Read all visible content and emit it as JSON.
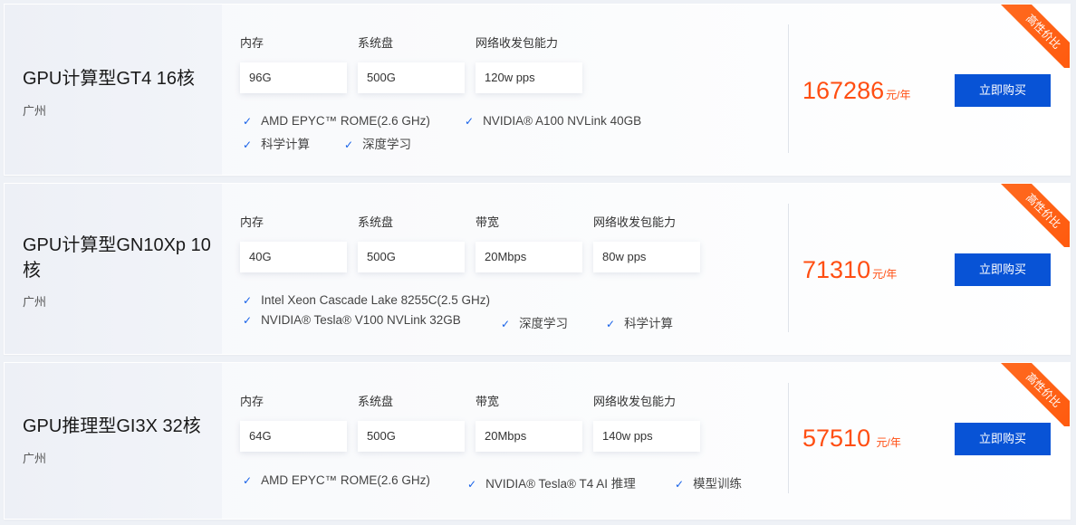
{
  "products": [
    {
      "title": "GPU计算型GT4 16核",
      "region": "广州",
      "specs": [
        {
          "label": "内存",
          "value": "96G"
        },
        {
          "label": "系统盘",
          "value": "500G"
        },
        {
          "label": "网络收发包能力",
          "value": "120w pps"
        }
      ],
      "features": [
        "AMD EPYC™ ROME(2.6 GHz)",
        "NVIDIA® A100 NVLink 40GB",
        "科学计算",
        "深度学习"
      ],
      "price": "167286",
      "unit": "元/年",
      "button": "立即购买",
      "badge": "高性价比"
    },
    {
      "title": "GPU计算型GN10Xp 10核",
      "region": "广州",
      "specs": [
        {
          "label": "内存",
          "value": "40G"
        },
        {
          "label": "系统盘",
          "value": "500G"
        },
        {
          "label": "带宽",
          "value": "20Mbps"
        },
        {
          "label": "网络收发包能力",
          "value": "80w pps"
        }
      ],
      "features": [
        "Intel Xeon Cascade Lake 8255C(2.5 GHz)",
        "NVIDIA® Tesla® V100 NVLink 32GB",
        "深度学习",
        "科学计算"
      ],
      "price": "71310",
      "unit": "元/年",
      "button": "立即购买",
      "badge": "高性价比"
    },
    {
      "title": "GPU推理型GI3X 32核",
      "region": "广州",
      "specs": [
        {
          "label": "内存",
          "value": "64G"
        },
        {
          "label": "系统盘",
          "value": "500G"
        },
        {
          "label": "带宽",
          "value": "20Mbps"
        },
        {
          "label": "网络收发包能力",
          "value": "140w pps"
        }
      ],
      "features": [
        "AMD EPYC™ ROME(2.6 GHz)",
        "NVIDIA® Tesla® T4 AI 推理",
        "模型训练"
      ],
      "price": "57510",
      "unit": "元/年",
      "button": "立即购买",
      "badge": "高性价比"
    }
  ],
  "colors": {
    "price": "#ff4e12",
    "button": "#0853d6",
    "check": "#1661e8",
    "ribbon": "#ff5a0e"
  }
}
